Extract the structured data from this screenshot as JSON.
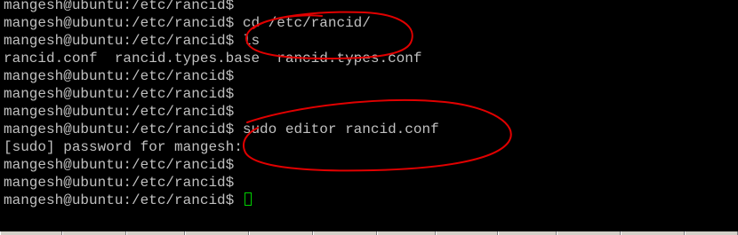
{
  "terminal": {
    "lines": [
      {
        "prompt": "mangesh@ubuntu:/etc/rancid$",
        "command": ""
      },
      {
        "prompt": "mangesh@ubuntu:/etc/rancid$",
        "command": " cd /etc/rancid/"
      },
      {
        "prompt": "mangesh@ubuntu:/etc/rancid$",
        "command": " ls"
      },
      {
        "prompt": "",
        "command": "rancid.conf  rancid.types.base  rancid.types.conf"
      },
      {
        "prompt": "mangesh@ubuntu:/etc/rancid$",
        "command": ""
      },
      {
        "prompt": "mangesh@ubuntu:/etc/rancid$",
        "command": ""
      },
      {
        "prompt": "mangesh@ubuntu:/etc/rancid$",
        "command": ""
      },
      {
        "prompt": "mangesh@ubuntu:/etc/rancid$",
        "command": " sudo editor rancid.conf"
      },
      {
        "prompt": "",
        "command": "[sudo] password for mangesh:"
      },
      {
        "prompt": "mangesh@ubuntu:/etc/rancid$",
        "command": ""
      },
      {
        "prompt": "mangesh@ubuntu:/etc/rancid$",
        "command": ""
      },
      {
        "prompt": "mangesh@ubuntu:/etc/rancid$",
        "command": " "
      }
    ],
    "text_color": "#c0c0c0",
    "background": "#000000",
    "cursor_color": "#00d000",
    "annotation_color": "#e00000"
  }
}
